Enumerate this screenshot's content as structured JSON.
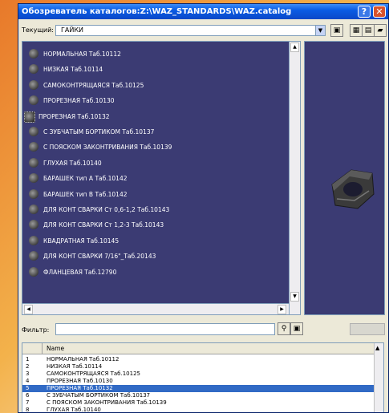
{
  "window": {
    "title": "Обозреватель каталогов:Z:\\WAZ_STANDARDS\\WAZ.catalog"
  },
  "current": {
    "label": "Текущий:",
    "value": "ГАЙКИ"
  },
  "catalog_items": [
    "НОРМАЛЬНАЯ Таб.10112",
    "НИЗКАЯ Таб.10114",
    "САМОКОНТРЯЩАЯСЯ Таб.10125",
    "ПРОРЕЗНАЯ Таб.10130",
    "ПРОРЕЗНАЯ Таб.10132",
    "С ЗУБЧАТЫМ БОРТИКОМ Таб.10137",
    "С ПОЯСКОМ ЗАКОНТРИВАНИЯ Таб.10139",
    "ГЛУХАЯ Таб.10140",
    "БАРАШЕК тип А Таб.10142",
    "БАРАШЕК тип В Таб.10142",
    "ДЛЯ КОНТ СВАРКИ Ст 0,6-1,2 Таб.10143",
    "ДЛЯ КОНТ СВАРКИ Ст 1,2-3 Таб.10143",
    "КВАДРАТНАЯ Таб.10145",
    "ДЛЯ КОНТ СВАРКИ 7/16\"_Таб.20143",
    "ФЛАНЦЕВАЯ Таб.12790"
  ],
  "selected_index": 4,
  "filter": {
    "label": "Фильтр:",
    "value": ""
  },
  "table": {
    "header": "Name",
    "rows": [
      {
        "n": "1",
        "name": "НОРМАЛЬНАЯ Таб.10112"
      },
      {
        "n": "2",
        "name": "НИЗКАЯ Таб.10114"
      },
      {
        "n": "3",
        "name": "САМОКОНТРЯЩАЯСЯ Таб.10125"
      },
      {
        "n": "4",
        "name": "ПРОРЕЗНАЯ Таб.10130"
      },
      {
        "n": "5",
        "name": "ПРОРЕЗНАЯ Таб.10132"
      },
      {
        "n": "6",
        "name": "С ЗУБЧАТЫМ БОРТИКОМ Таб.10137"
      },
      {
        "n": "7",
        "name": "С ПОЯСКОМ ЗАКОНТРИВАНИЯ Таб.10139"
      },
      {
        "n": "8",
        "name": "ГЛУХАЯ Таб.10140"
      }
    ]
  }
}
